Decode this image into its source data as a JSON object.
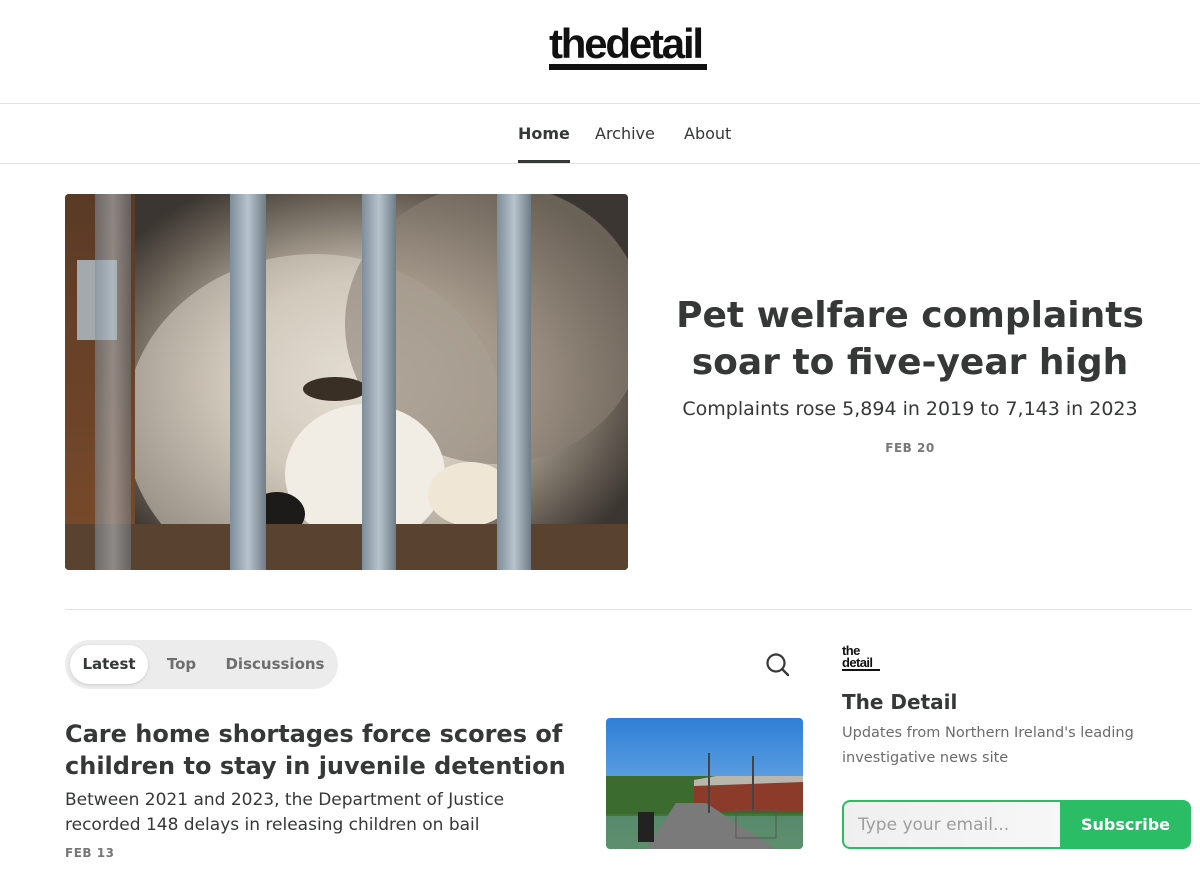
{
  "site": {
    "logo_text": "thedetail"
  },
  "nav": {
    "items": [
      {
        "label": "Home",
        "active": true
      },
      {
        "label": "Archive",
        "active": false
      },
      {
        "label": "About",
        "active": false
      }
    ]
  },
  "hero": {
    "title": "Pet welfare complaints soar to five-year high",
    "subtitle": "Complaints rose 5,894 in 2019 to 7,143 in 2023",
    "date": "FEB 20"
  },
  "tabs": {
    "items": [
      {
        "label": "Latest",
        "active": true
      },
      {
        "label": "Top",
        "active": false
      },
      {
        "label": "Discussions",
        "active": false
      }
    ]
  },
  "post": {
    "title": "Care home shortages force scores of children to stay in juvenile detention",
    "subtitle": "Between 2021 and 2023, the Department of Justice recorded 148 delays in releasing children on bail",
    "date": "FEB 13"
  },
  "sidebar": {
    "logo_top": "the",
    "logo_bottom": "detail",
    "name": "The Detail",
    "description": "Updates from Northern Ireland's leading investigative news site",
    "email_placeholder": "Type your email...",
    "subscribe_label": "Subscribe"
  },
  "colors": {
    "accent": "#2bbd66",
    "text": "#363737",
    "muted": "#777777"
  }
}
